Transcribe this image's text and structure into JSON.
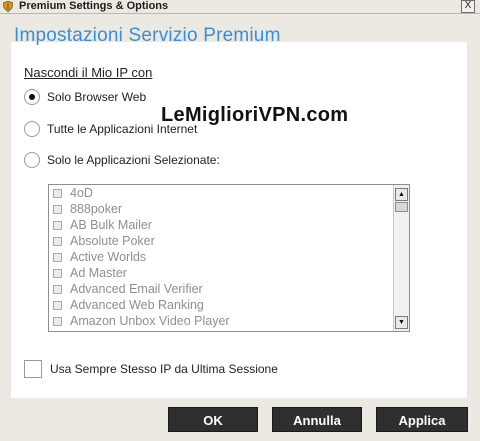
{
  "window": {
    "title": "Premium Settings & Options",
    "close_glyph": "X"
  },
  "heading": "Impostazioni Servizio Premium",
  "group_label": "Nascondi il Mio IP con",
  "radios": [
    {
      "label": "Solo Browser Web",
      "selected": true
    },
    {
      "label": "Tutte le Applicazioni Internet",
      "selected": false
    },
    {
      "label": "Solo le Applicazioni Selezionate:",
      "selected": false
    }
  ],
  "watermark": "LeMiglioriVPN.com",
  "app_list": [
    "4oD",
    "888poker",
    "AB Bulk Mailer",
    "Absolute Poker",
    "Active Worlds",
    "Ad Master",
    "Advanced Email Verifier",
    "Advanced Web Ranking",
    "Amazon Unbox Video Player"
  ],
  "same_ip_checkbox": {
    "label": "Usa Sempre Stesso IP da Ultima Sessione",
    "checked": false
  },
  "buttons": {
    "ok": "OK",
    "cancel": "Annulla",
    "apply": "Applica"
  },
  "icons": {
    "app": "shield-icon",
    "close": "close-icon",
    "scroll_up": "arrow-up-icon",
    "scroll_down": "arrow-down-icon"
  },
  "colors": {
    "heading": "#3c8ed2",
    "button_bg": "#2f2f2f",
    "window_bg": "#ece9e2"
  }
}
